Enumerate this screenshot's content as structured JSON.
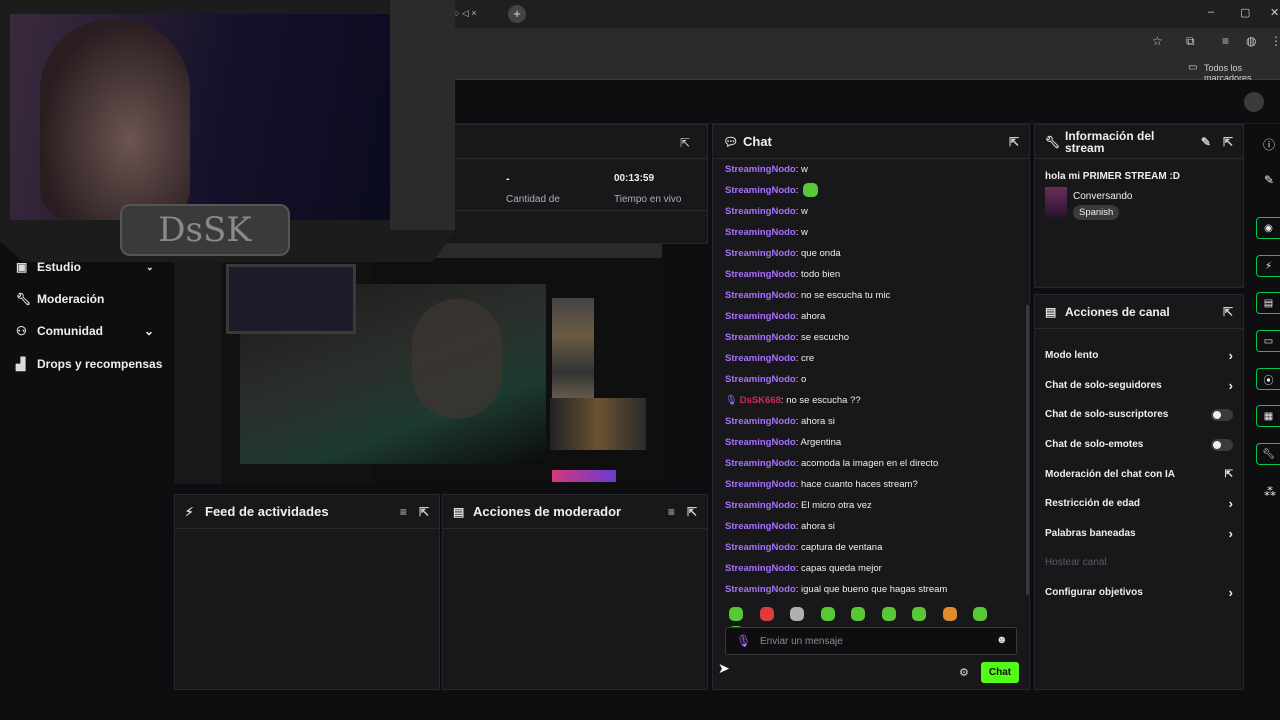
{
  "bookmarks": {
    "folder_label": "Todos los marcadores"
  },
  "stats": {
    "viewers_value": "-",
    "viewers_label": "Cantidad de",
    "live_time_value": "00:13:59",
    "live_time_label": "Tiempo en vivo"
  },
  "nav": {
    "items": [
      {
        "label": "Estudio",
        "icon": "studio-icon"
      },
      {
        "label": "Moderación",
        "icon": "wrench-icon"
      },
      {
        "label": "Comunidad",
        "icon": "community-icon"
      },
      {
        "label": "Drops y recompensas",
        "icon": "drops-icon"
      }
    ]
  },
  "webcam": {
    "overlay_text": "DsSK"
  },
  "activity_feed": {
    "title": "Feed de actividades"
  },
  "mod_actions": {
    "title": "Acciones de moderador"
  },
  "chat": {
    "title": "Chat",
    "messages": [
      {
        "user": "StreamingNodo",
        "text": "w"
      },
      {
        "user": "StreamingNodo",
        "text": ""
      },
      {
        "user": "StreamingNodo",
        "text": "w"
      },
      {
        "user": "StreamingNodo",
        "text": "w"
      },
      {
        "user": "StreamingNodo",
        "text": "que onda"
      },
      {
        "user": "StreamingNodo",
        "text": "todo bien"
      },
      {
        "user": "StreamingNodo",
        "text": "no se escucha tu mic"
      },
      {
        "user": "StreamingNodo",
        "text": "ahora"
      },
      {
        "user": "StreamingNodo",
        "text": "se escucho"
      },
      {
        "user": "StreamingNodo",
        "text": "cre"
      },
      {
        "user": "StreamingNodo",
        "text": "o"
      },
      {
        "user": "DsSK668",
        "text": "no se escucha ??"
      },
      {
        "user": "StreamingNodo",
        "text": "ahora si"
      },
      {
        "user": "StreamingNodo",
        "text": "Argentina"
      },
      {
        "user": "StreamingNodo",
        "text": "acomoda la imagen en el directo"
      },
      {
        "user": "StreamingNodo",
        "text": "hace cuanto haces stream?"
      },
      {
        "user": "StreamingNodo",
        "text": "El micro otra vez"
      },
      {
        "user": "StreamingNodo",
        "text": "ahora si"
      },
      {
        "user": "StreamingNodo",
        "text": "captura de ventana"
      },
      {
        "user": "StreamingNodo",
        "text": "capas queda mejor"
      },
      {
        "user": "StreamingNodo",
        "text": "igual que bueno que hagas stream"
      }
    ],
    "input_placeholder": "Enviar un mensaje",
    "send_label": "Chat",
    "emote_colors": [
      "#59c836",
      "#e03b3b",
      "#b0b0b0",
      "#59c836",
      "#59c836",
      "#59c836",
      "#59c836",
      "#e08a2b",
      "#59c836",
      "#59c836"
    ]
  },
  "stream_info": {
    "title": "Información del stream",
    "stream_title": "hola mi PRIMER STREAM :D",
    "category": "Conversando",
    "language_tag": "Spanish"
  },
  "channel_actions": {
    "title": "Acciones de canal",
    "items": [
      {
        "label": "Modo lento",
        "control": "chevron"
      },
      {
        "label": "Chat de solo-seguidores",
        "control": "chevron"
      },
      {
        "label": "Chat de solo-suscriptores",
        "control": "toggle"
      },
      {
        "label": "Chat de solo-emotes",
        "control": "toggle"
      },
      {
        "label": "Moderación del chat con IA",
        "control": "external"
      },
      {
        "label": "Restricción de edad",
        "control": "chevron"
      },
      {
        "label": "Palabras baneadas",
        "control": "chevron"
      },
      {
        "label": "Hostear canal",
        "control": "none"
      },
      {
        "label": "Configurar objetivos",
        "control": "chevron"
      }
    ]
  },
  "colors": {
    "accent_green": "#53fc18",
    "username_purple": "#a970ff",
    "panel_bg": "#18181b"
  }
}
